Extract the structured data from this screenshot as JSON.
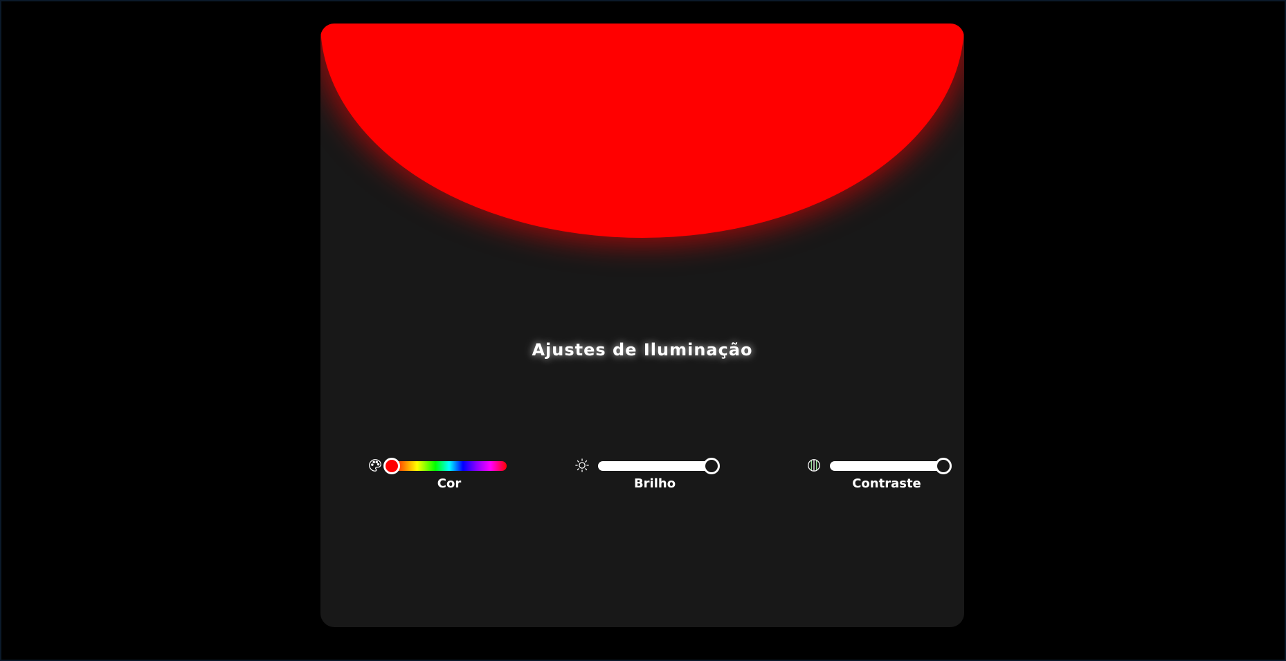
{
  "panel": {
    "title": "Ajustes de Iluminação",
    "lamp_color": "#ff0000"
  },
  "controls": [
    {
      "id": "color",
      "label": "Cor",
      "icon": "palette-icon",
      "value": 0,
      "thumb_color": "#ff0000"
    },
    {
      "id": "brightness",
      "label": "Brilho",
      "icon": "sun-icon",
      "value": 1,
      "thumb_color": "#181818"
    },
    {
      "id": "contrast",
      "label": "Contraste",
      "icon": "contrast-icon",
      "value": 1,
      "thumb_color": "#181818"
    }
  ]
}
